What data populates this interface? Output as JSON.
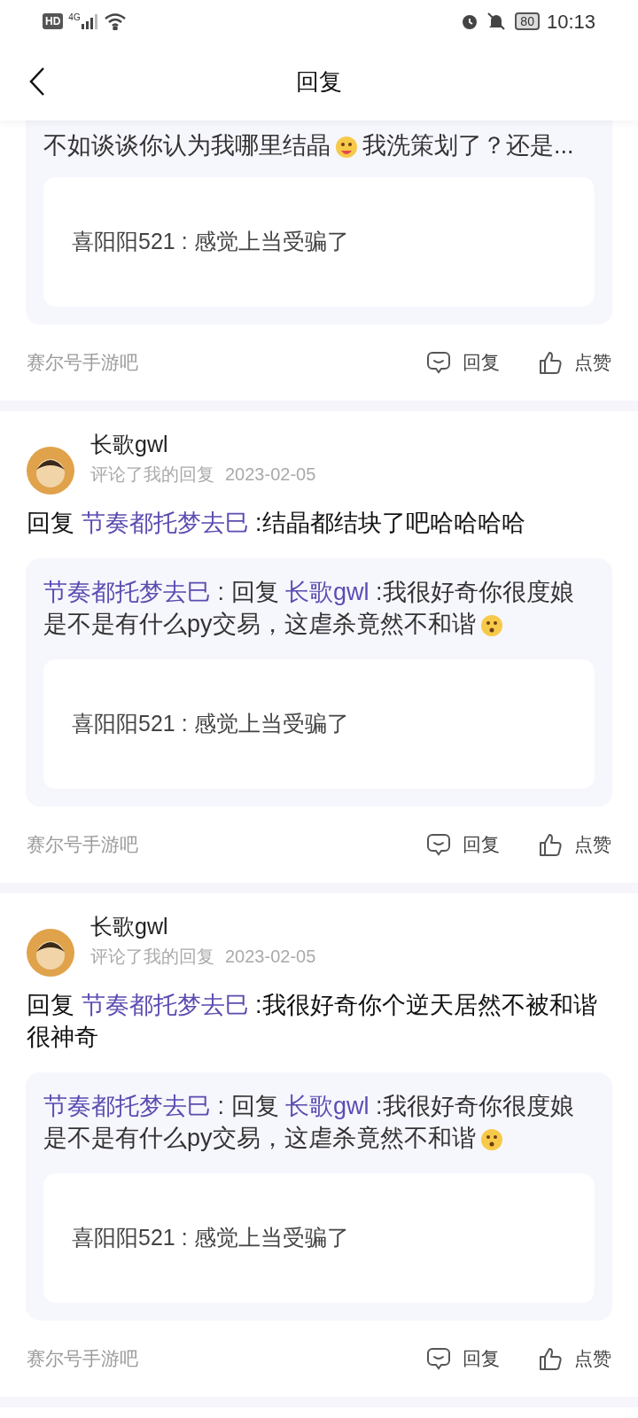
{
  "status_bar": {
    "hd": "HD",
    "network": "4G",
    "battery": "80",
    "time": "10:13"
  },
  "header": {
    "title": "回复"
  },
  "items": [
    {
      "kind": "partial",
      "quote": {
        "text": "不如谈谈你认为我哪里结晶",
        "text_after": "我洗策划了？还是..."
      },
      "nested": "喜阳阳521 : 感觉上当受骗了",
      "source": "赛尔号手游吧",
      "actions": [
        "回复",
        "点赞"
      ]
    },
    {
      "kind": "full",
      "user": "长歌gwl",
      "action": "评论了我的回复",
      "date": "2023-02-05",
      "body": {
        "prefix": "回复",
        "mention": "节奏都托梦去巳",
        "text": ":结晶都结块了吧哈哈哈哈"
      },
      "quote": {
        "author": "节奏都托梦去巳",
        "sep": ": 回复",
        "mention": "长歌gwl",
        "text": ":我很好奇你很度娘是不是有什么py交易，这虐杀竟然不和谐"
      },
      "nested": "喜阳阳521 : 感觉上当受骗了",
      "source": "赛尔号手游吧",
      "actions": [
        "回复",
        "点赞"
      ]
    },
    {
      "kind": "full",
      "user": "长歌gwl",
      "action": "评论了我的回复",
      "date": "2023-02-05",
      "body": {
        "prefix": "回复",
        "mention": "节奏都托梦去巳",
        "text": ":我很好奇你个逆天居然不被和谐很神奇"
      },
      "quote": {
        "author": "节奏都托梦去巳",
        "sep": ": 回复",
        "mention": "长歌gwl",
        "text": ":我很好奇你很度娘是不是有什么py交易，这虐杀竟然不和谐"
      },
      "nested": "喜阳阳521 : 感觉上当受骗了",
      "source": "赛尔号手游吧",
      "actions": [
        "回复",
        "点赞"
      ]
    }
  ]
}
